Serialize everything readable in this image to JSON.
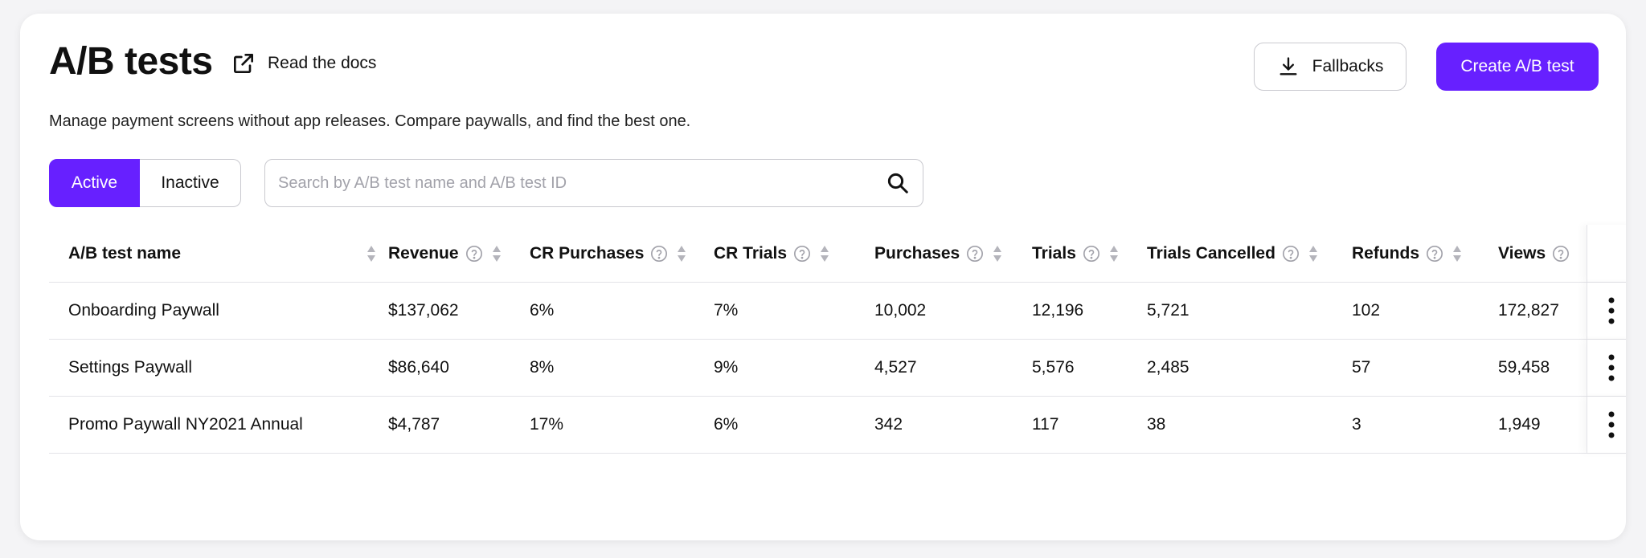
{
  "header": {
    "title": "A/B tests",
    "docs_link": "Read the docs",
    "subtitle": "Manage payment screens without app releases. Compare paywalls, and find the best one.",
    "fallbacks_button": "Fallbacks",
    "create_button": "Create A/B test"
  },
  "filters": {
    "active_label": "Active",
    "inactive_label": "Inactive",
    "selected": "Active",
    "search_placeholder": "Search by A/B test name and A/B test ID",
    "search_value": ""
  },
  "colors": {
    "accent": "#6720ff",
    "border": "#c9c9cf",
    "divider": "#e3e3e8"
  },
  "icons": {
    "docs": "external-link-icon",
    "fallbacks": "download-icon",
    "search": "search-icon",
    "help": "question-circle-icon",
    "sort": "sort-arrows-icon",
    "row_menu": "kebab-menu-icon"
  },
  "table": {
    "columns": [
      {
        "label": "A/B test name",
        "help": false
      },
      {
        "label": "Revenue",
        "help": true
      },
      {
        "label": "CR Purchases",
        "help": true
      },
      {
        "label": "CR Trials",
        "help": true
      },
      {
        "label": "Purchases",
        "help": true
      },
      {
        "label": "Trials",
        "help": true
      },
      {
        "label": "Trials Cancelled",
        "help": true
      },
      {
        "label": "Refunds",
        "help": true
      },
      {
        "label": "Views",
        "help": true
      }
    ],
    "rows": [
      [
        "Onboarding Paywall",
        "$137,062",
        "6%",
        "7%",
        "10,002",
        "12,196",
        "5,721",
        "102",
        "172,827"
      ],
      [
        "Settings Paywall",
        "$86,640",
        "8%",
        "9%",
        "4,527",
        "5,576",
        "2,485",
        "57",
        "59,458"
      ],
      [
        "Promo Paywall NY2021 Annual",
        "$4,787",
        "17%",
        "6%",
        "342",
        "117",
        "38",
        "3",
        "1,949"
      ]
    ]
  }
}
